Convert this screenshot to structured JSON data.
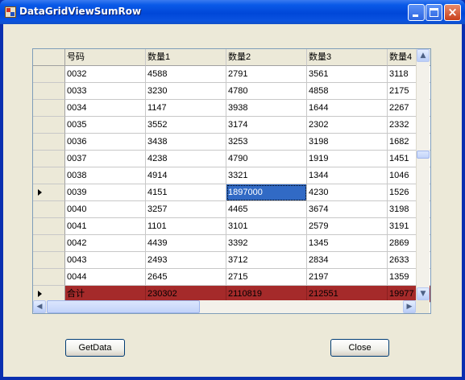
{
  "window": {
    "title": "DataGridViewSumRow"
  },
  "grid": {
    "columns": [
      "号码",
      "数量1",
      "数量2",
      "数量3",
      "数量4"
    ],
    "rows": [
      {
        "cells": [
          "0032",
          "4588",
          "2791",
          "3561",
          "3118"
        ]
      },
      {
        "cells": [
          "0033",
          "3230",
          "4780",
          "4858",
          "2175"
        ]
      },
      {
        "cells": [
          "0034",
          "1147",
          "3938",
          "1644",
          "2267"
        ]
      },
      {
        "cells": [
          "0035",
          "3552",
          "3174",
          "2302",
          "2332"
        ]
      },
      {
        "cells": [
          "0036",
          "3438",
          "3253",
          "3198",
          "1682"
        ]
      },
      {
        "cells": [
          "0037",
          "4238",
          "4790",
          "1919",
          "1451"
        ]
      },
      {
        "cells": [
          "0038",
          "4914",
          "3321",
          "1344",
          "1046"
        ]
      },
      {
        "cells": [
          "0039",
          "4151",
          "1897000",
          "4230",
          "1526"
        ],
        "current": true,
        "selected_col": 2
      },
      {
        "cells": [
          "0040",
          "3257",
          "4465",
          "3674",
          "3198"
        ]
      },
      {
        "cells": [
          "0041",
          "1101",
          "3101",
          "2579",
          "3191"
        ]
      },
      {
        "cells": [
          "0042",
          "4439",
          "3392",
          "1345",
          "2869"
        ]
      },
      {
        "cells": [
          "0043",
          "2493",
          "3712",
          "2834",
          "2633"
        ]
      },
      {
        "cells": [
          "0044",
          "2645",
          "2715",
          "2197",
          "1359"
        ]
      }
    ],
    "sum_row": {
      "cells": [
        "合计",
        "230302",
        "2110819",
        "212551",
        "19977"
      ]
    },
    "colors": {
      "sum_row": "#a52a2a",
      "selection": "#316ac5",
      "header": "#ece9d8"
    }
  },
  "buttons": {
    "getdata": "GetData",
    "close": "Close"
  }
}
